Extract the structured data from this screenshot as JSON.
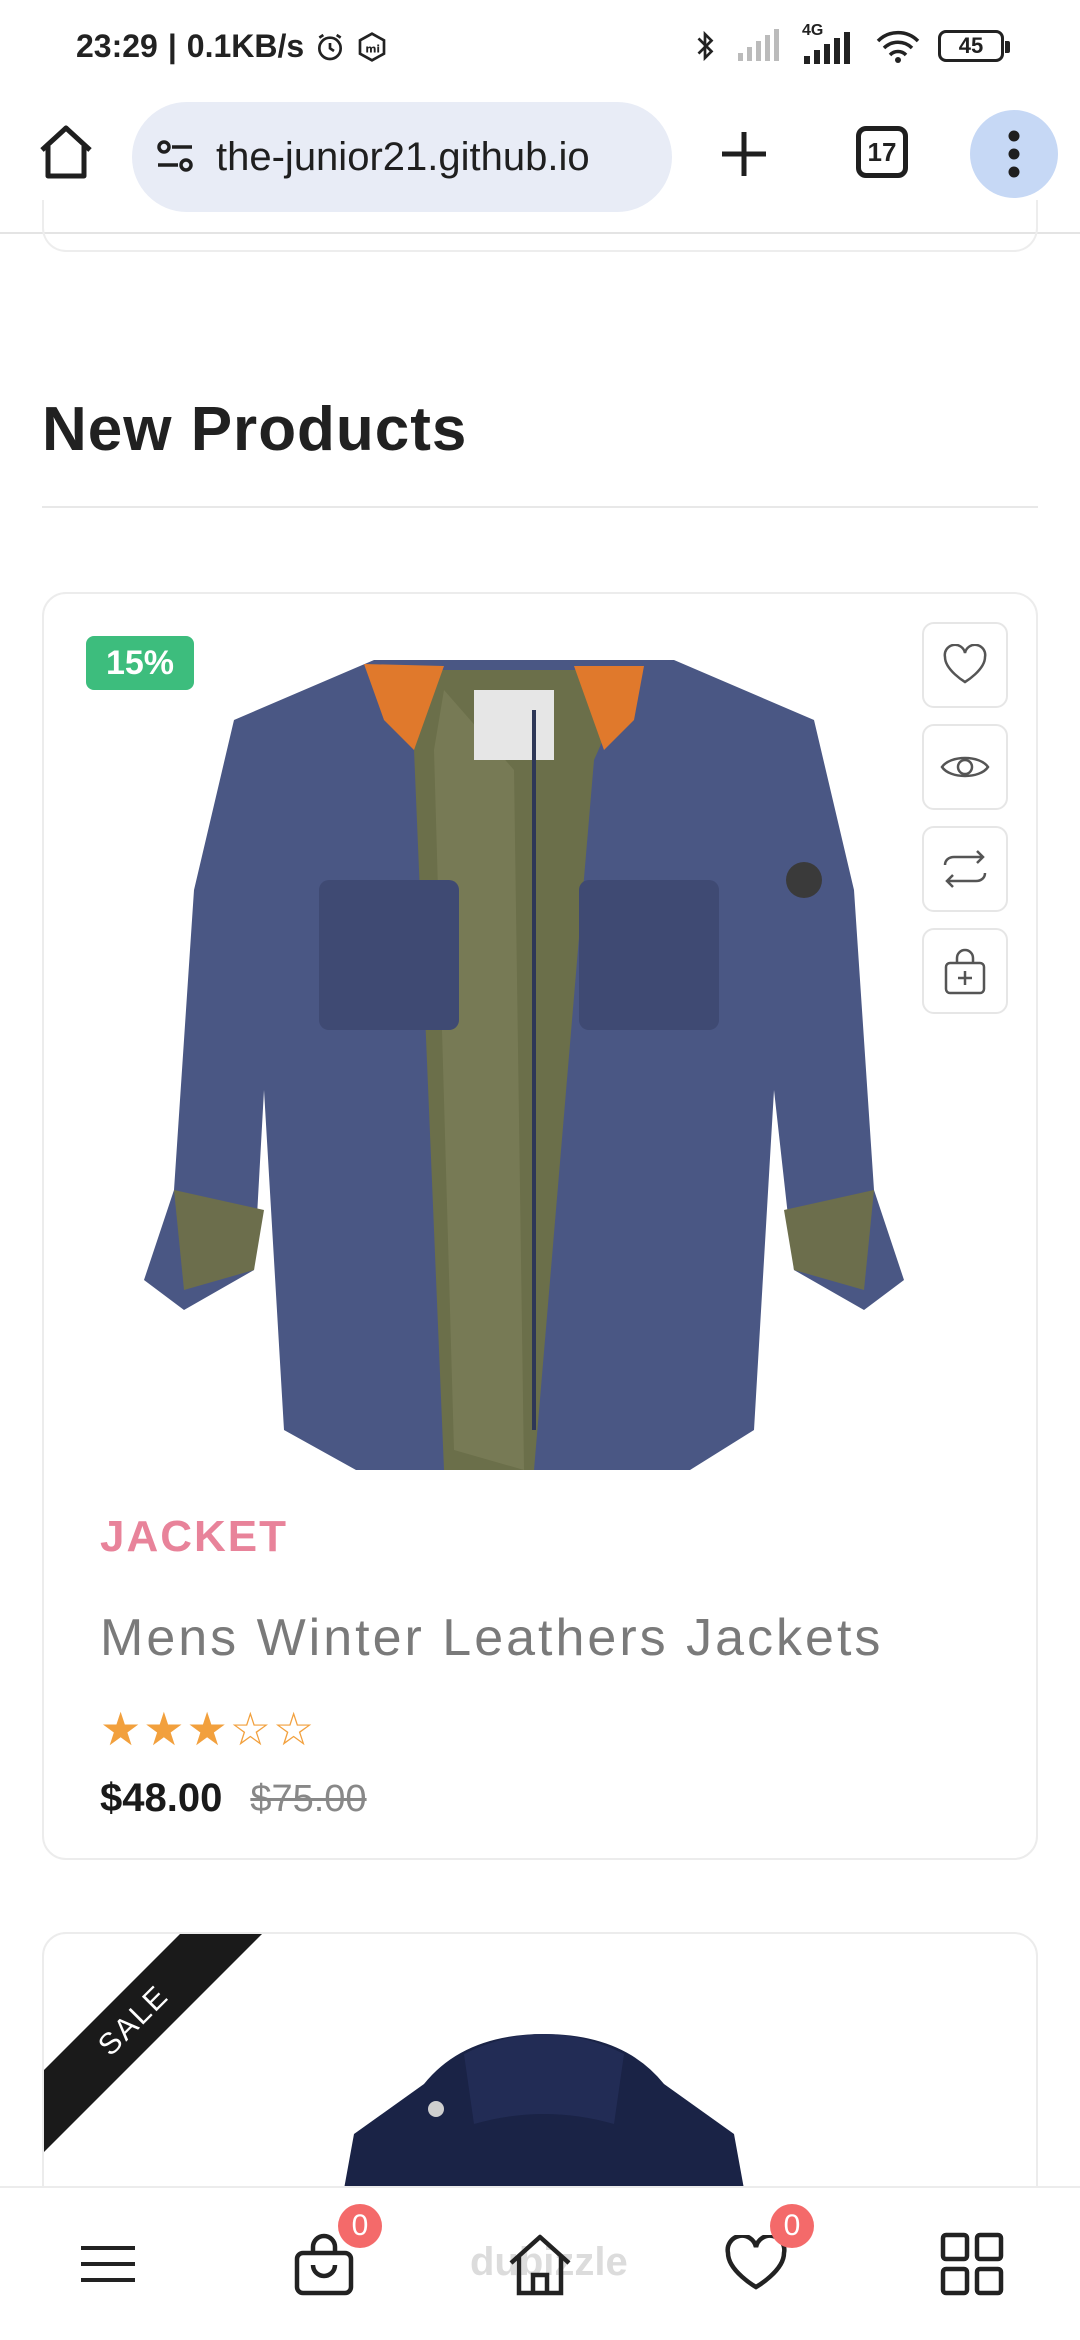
{
  "status_bar": {
    "time": "23:29",
    "network_speed": "0.1KB/s",
    "network_type": "4G",
    "battery": "45",
    "icons": [
      "alarm-icon",
      "mi-icon",
      "bluetooth-icon",
      "signal-icon",
      "wifi-icon",
      "battery-icon"
    ]
  },
  "browser": {
    "url": "the-junior21.github.io",
    "tab_count": "17"
  },
  "section": {
    "title": "New Products"
  },
  "product": {
    "discount": "15%",
    "category": "JACKET",
    "title": "Mens Winter Leathers Jackets",
    "rating_value": 3,
    "rating_max": 5,
    "price": "$48.00",
    "old_price": "$75.00",
    "actions": [
      "heart-icon",
      "eye-icon",
      "repeat-icon",
      "bag-add-icon"
    ]
  },
  "product2": {
    "ribbon": "SALE"
  },
  "bottom_nav": {
    "cart_count": "0",
    "wishlist_count": "0",
    "watermark": "dubizzle"
  },
  "colors": {
    "badge_green": "#3dbd7d",
    "category_pink": "#e8839a",
    "star_orange": "#f2a03d",
    "nav_badge_red": "#f46a6a",
    "url_pill": "#e8ecf6",
    "menu_bg": "#c6d8f5"
  }
}
